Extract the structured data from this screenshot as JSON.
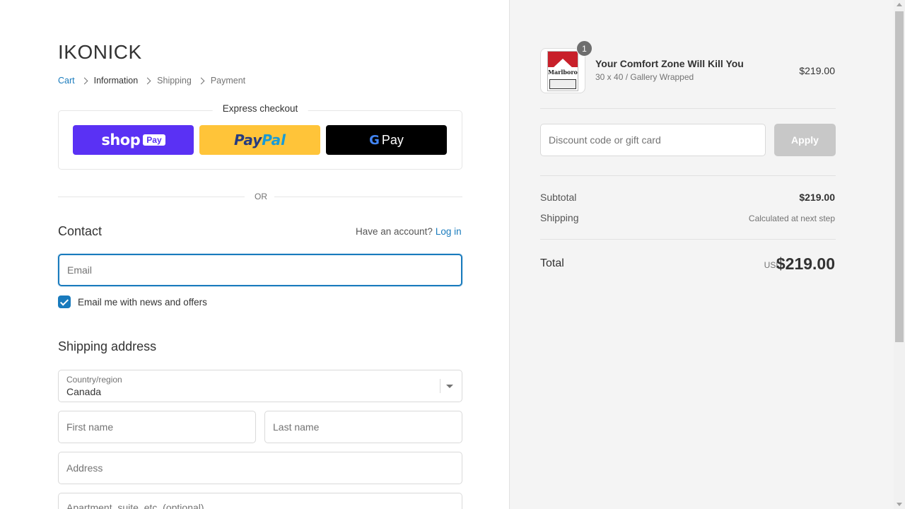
{
  "store": {
    "name": "IKONICK"
  },
  "breadcrumb": {
    "items": [
      "Cart",
      "Information",
      "Shipping",
      "Payment"
    ]
  },
  "express": {
    "title": "Express checkout",
    "shoppay_label": "shop",
    "shoppay_pay": "Pay",
    "paypal_part1": "Pay",
    "paypal_part2": "Pal",
    "gpay_g": "G",
    "gpay_label": "Pay",
    "colors": {
      "shoppay": "#5a31f4",
      "paypal": "#ffc439",
      "gpay": "#000000"
    }
  },
  "divider_text": "OR",
  "contact": {
    "title": "Contact",
    "have_account": "Have an account?",
    "login": "Log in",
    "email_placeholder": "Email",
    "newsletter_label": "Email me with news and offers",
    "newsletter_checked": true
  },
  "shipping": {
    "title": "Shipping address",
    "country_label": "Country/region",
    "country_value": "Canada",
    "first_name_placeholder": "First name",
    "last_name_placeholder": "Last name",
    "address_placeholder": "Address",
    "apartment_placeholder": "Apartment, suite, etc. (optional)"
  },
  "summary": {
    "product": {
      "quantity": "1",
      "name": "Your Comfort Zone Will Kill You",
      "variant": "30 x 40 / Gallery Wrapped",
      "price": "$219.00",
      "thumb_brand": "Marlboro"
    },
    "discount_placeholder": "Discount code or gift card",
    "apply_label": "Apply",
    "subtotal_label": "Subtotal",
    "subtotal_value": "$219.00",
    "shipping_label": "Shipping",
    "shipping_value": "Calculated at next step",
    "total_label": "Total",
    "total_currency": "USD",
    "total_value": "$219.00"
  },
  "theme": {
    "accent": "#197bbd"
  }
}
